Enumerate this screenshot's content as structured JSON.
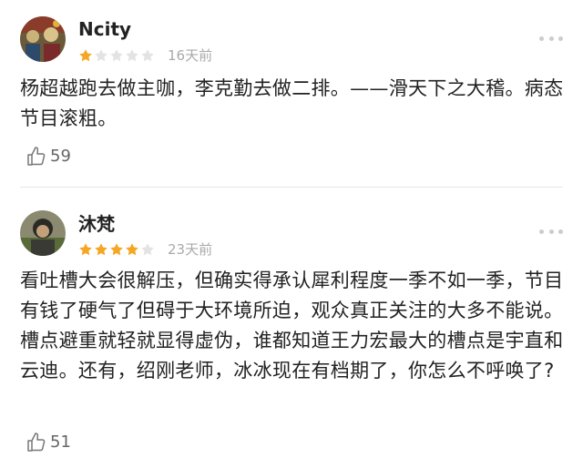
{
  "comments": [
    {
      "username": "Ncity",
      "rating": 1,
      "max_rating": 5,
      "time": "16天前",
      "content": "杨超越跑去做主咖，李克勤去做二排。——滑天下之大稽。病态节目滚粗。",
      "likes": "59"
    },
    {
      "username": "沐梵",
      "rating": 4,
      "max_rating": 5,
      "time": "23天前",
      "content": "看吐槽大会很解压，但确实得承认犀利程度一季不如一季，节目有钱了硬气了但碍于大环境所迫，观众真正关注的大多不能说。槽点避重就轻就显得虚伪，谁都知道王力宏最大的槽点是宇直和云迪。还有，绍刚老师，冰冰现在有档期了，你怎么不呼唤了?",
      "likes": "51"
    }
  ],
  "colors": {
    "star_filled": "#f5a623",
    "star_empty": "#e3e3e3",
    "meta_text": "#aaaaaa",
    "body_text": "#222222"
  },
  "icons": {
    "like": "thumbs-up-icon",
    "more": "more-dots-icon"
  }
}
